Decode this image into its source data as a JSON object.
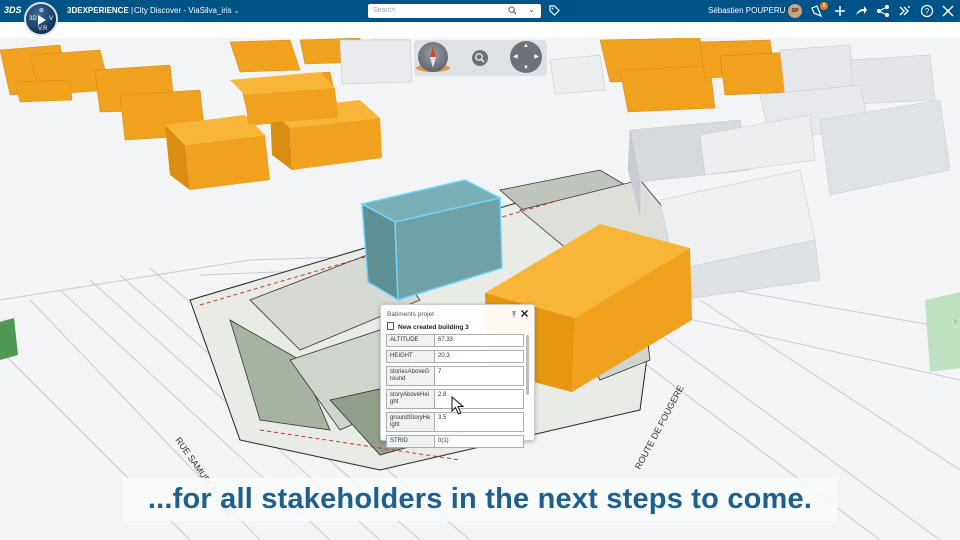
{
  "topbar": {
    "brand_logo": "3DS",
    "compass": {
      "top": "⊕",
      "left": "3D",
      "right": "V",
      "bottom": "V.R"
    },
    "app_name_bold": "3DEXPERIENCE",
    "app_name_sep": " | ",
    "context_title": "City Discover - ViaSilva_iris",
    "search_placeholder": "Search",
    "user_name": "Sébastien POUPERU",
    "user_initials": "SP",
    "notification_count": "8",
    "icons": [
      "tag-icon",
      "share-icon",
      "add-icon",
      "forward-icon",
      "network-icon",
      "apps-icon",
      "help-icon",
      "tools-icon"
    ]
  },
  "viewport": {
    "colors": {
      "accent": "#005386",
      "building_orange": "#f0a21e",
      "building_white": "#e7e9ec",
      "selected_building": "#6fa1a6",
      "caption_text": "#1d5f8f"
    },
    "street_labels": [
      "RUE SAMUEL MORSE",
      "ROUTE DE FOUGERE"
    ]
  },
  "nav_tools": {
    "icons": [
      "compass-icon",
      "zoom-icon",
      "pan-icon"
    ]
  },
  "panel": {
    "title": "Batiments projet",
    "object_name": "New created building 3",
    "attributes": [
      {
        "key": "ALTITUDE",
        "value": "67.33"
      },
      {
        "key": "HEIGHT",
        "value": "20.3"
      },
      {
        "key": "storiesAboveGround",
        "value": "7"
      },
      {
        "key": "storyAboveHeight",
        "value": "2.8"
      },
      {
        "key": "groundStoryHeight",
        "value": "3.5"
      },
      {
        "key": "STRID",
        "value": "0(1)"
      }
    ]
  },
  "caption": "...for all stakeholders in the next steps to come."
}
